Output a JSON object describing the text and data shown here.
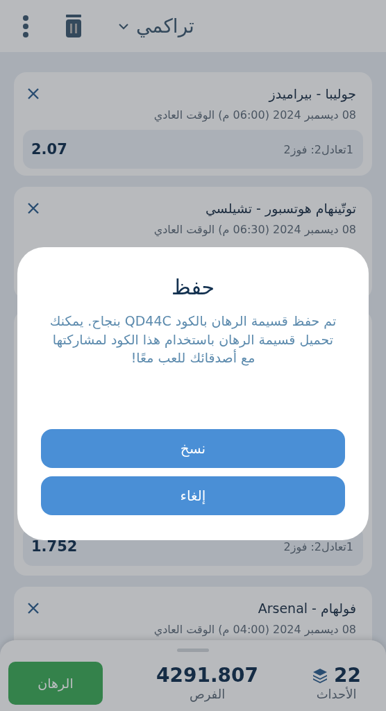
{
  "header": {
    "title": "تراكمي"
  },
  "cards": [
    {
      "match": "جوليبا - بيراميدز",
      "date": "08 ديسمبر 2024 (06:00 م) الوقت العادي",
      "selection": "1تعادل2: فوز2",
      "odds": "2.07",
      "kind": "full"
    },
    {
      "match": "توتّينهام هوتسبور - تشيلسي",
      "date": "08 ديسمبر 2024 (06:30 م) الوقت العادي",
      "kind": "top"
    },
    {
      "selection": "1تعادل2: فوز2",
      "odds": "1.752",
      "kind": "bottom"
    },
    {
      "match": "فولهام - Arsenal",
      "date": "08 ديسمبر 2024 (04:00 م) الوقت العادي",
      "kind": "top"
    }
  ],
  "dialog": {
    "title": "حفظ",
    "message": "تم حفظ قسيمة الرهان بالكود QD44C بنجاح. يمكنك تحميل قسيمة الرهان باستخدام هذا الكود لمشاركتها مع أصدقائك للعب معًا!",
    "buttons": [
      "نسخ",
      "إلغاء"
    ]
  },
  "bottom_bar": {
    "bet_button": "الرهان",
    "odds": "4291.807",
    "odds_label": "الفرص",
    "events": "22",
    "events_label": "الأحداث"
  }
}
